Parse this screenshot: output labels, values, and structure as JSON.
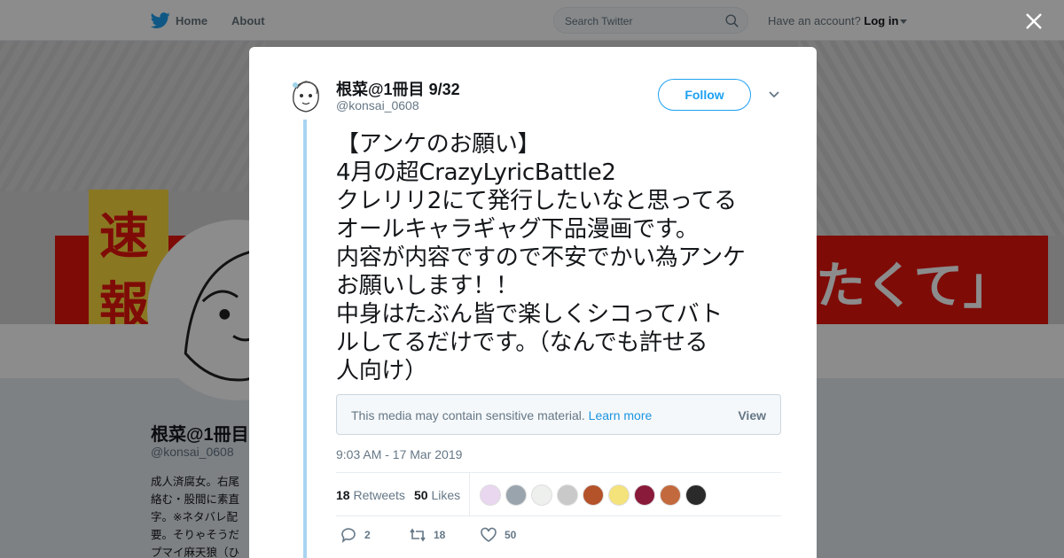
{
  "nav": {
    "home_label": "Home",
    "about_label": "About",
    "search_placeholder": "Search Twitter",
    "account_prompt": "Have an account?",
    "login_label": "Log in"
  },
  "profile": {
    "name": "根菜@1冊目",
    "handle": "@konsai_0608",
    "bio": "成人済腐女。右尾\n絡む・股間に素直\n字。※ネタバレ配\n要。そりゃそうだ\nプマイ麻天狼（ひ",
    "banner_text": [
      "速",
      "報",
      "たくて」"
    ]
  },
  "tweet": {
    "author_name": "根菜@1冊目 9/32",
    "author_handle": "@konsai_0608",
    "follow_label": "Follow",
    "text_lines": [
      "【アンケのお願い】",
      "4月の超CrazyLyricBattle2",
      "クレリリ2にて発行したいなと思ってる",
      "オールキャラギャグ下品漫画です。",
      "内容が内容ですので不安でかい為アンケ",
      "お願いします！！",
      "中身はたぶん皆で楽しくシコってバト",
      "ルしてるだけです。（なんでも許せる",
      "人向け）"
    ],
    "sensitive_notice": "This media may contain sensitive material.",
    "learn_more": "Learn more",
    "view_label": "View",
    "timestamp": "9:03 AM - 17 Mar 2019",
    "retweets_count": "18",
    "retweets_label": "Retweets",
    "likes_count": "50",
    "likes_label": "Likes",
    "reply_count": "2",
    "retweet_action_count": "18",
    "like_action_count": "50"
  },
  "liker_colors": [
    "#e9d7f0",
    "#9aa4ad",
    "#eef0ee",
    "#c9c9c9",
    "#b4522a",
    "#f4e27a",
    "#8a1a3a",
    "#c2693d",
    "#2a2a2a"
  ],
  "colors": {
    "accent": "#1da1f2",
    "thread": "#a7d4f0",
    "muted": "#657786"
  }
}
